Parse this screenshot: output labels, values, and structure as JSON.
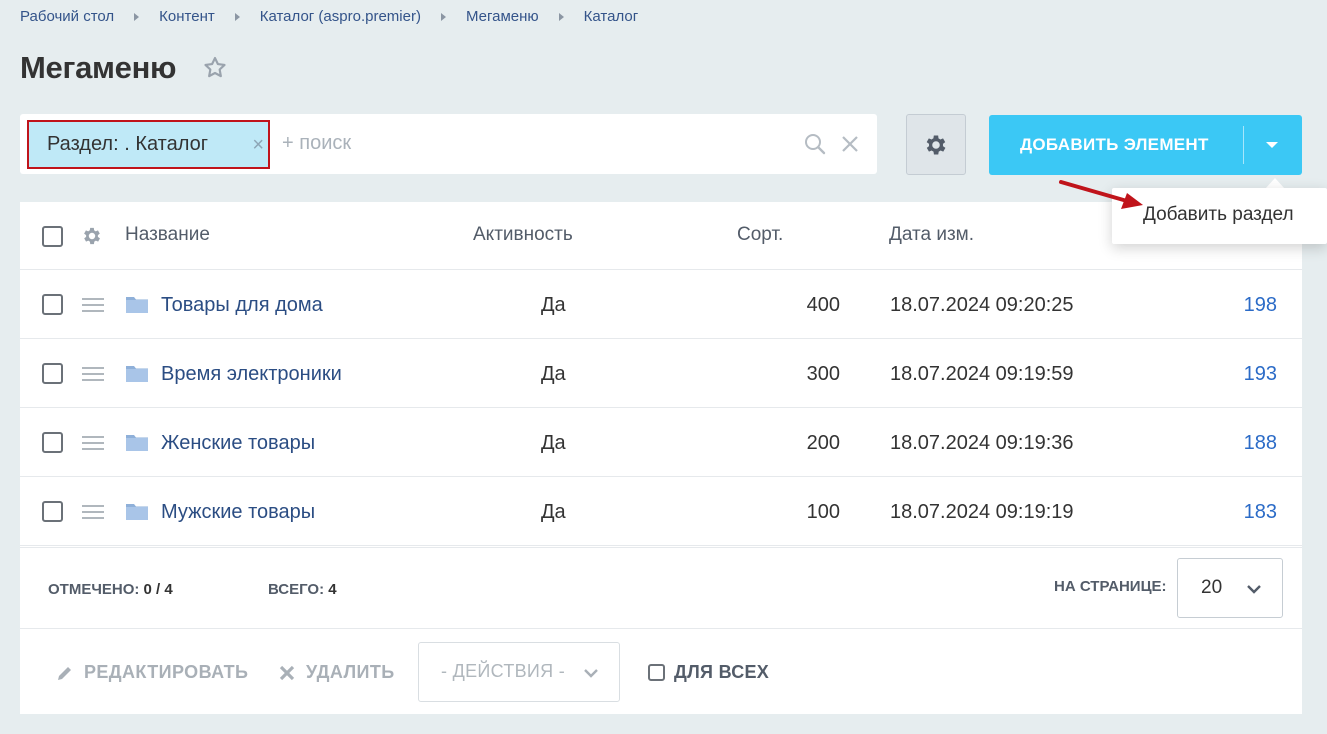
{
  "breadcrumb": [
    "Рабочий стол",
    "Контент",
    "Каталог (aspro.premier)",
    "Мегаменю",
    "Каталог"
  ],
  "page": {
    "title": "Мегаменю"
  },
  "filter": {
    "chip_label": "Раздел: . Каталог",
    "chip_close": "×",
    "search_placeholder": "+ поиск"
  },
  "toolbar": {
    "add_label": "ДОБАВИТЬ ЭЛЕМЕНТ"
  },
  "dropdown": {
    "add_section": "Добавить раздел"
  },
  "table": {
    "headers": {
      "name": "Название",
      "active": "Активность",
      "sort": "Сорт.",
      "date": "Дата изм."
    },
    "rows": [
      {
        "name": "Товары для дома",
        "active": "Да",
        "sort": "400",
        "date": "18.07.2024 09:20:25",
        "id": "198"
      },
      {
        "name": "Время электроники",
        "active": "Да",
        "sort": "300",
        "date": "18.07.2024 09:19:59",
        "id": "193"
      },
      {
        "name": "Женские товары",
        "active": "Да",
        "sort": "200",
        "date": "18.07.2024 09:19:36",
        "id": "188"
      },
      {
        "name": "Мужские товары",
        "active": "Да",
        "sort": "100",
        "date": "18.07.2024 09:19:19",
        "id": "183"
      }
    ]
  },
  "summary": {
    "selected_label": "ОТМЕЧЕНО:",
    "selected_value": "0 / 4",
    "total_label": "ВСЕГО:",
    "total_value": "4",
    "per_page_label": "НА СТРАНИЦЕ:",
    "per_page_value": "20"
  },
  "actions": {
    "edit": "РЕДАКТИРОВАТЬ",
    "delete": "УДАЛИТЬ",
    "actions_select": "- ДЕЙСТВИЯ -",
    "for_all": "ДЛЯ ВСЕХ"
  },
  "colors": {
    "background": "#e6edef",
    "accent": "#3bc8f5",
    "link": "#2b4d83",
    "id_link": "#2b6bc7",
    "highlight": "#c0141b",
    "chip_bg": "#bfe9f7"
  }
}
